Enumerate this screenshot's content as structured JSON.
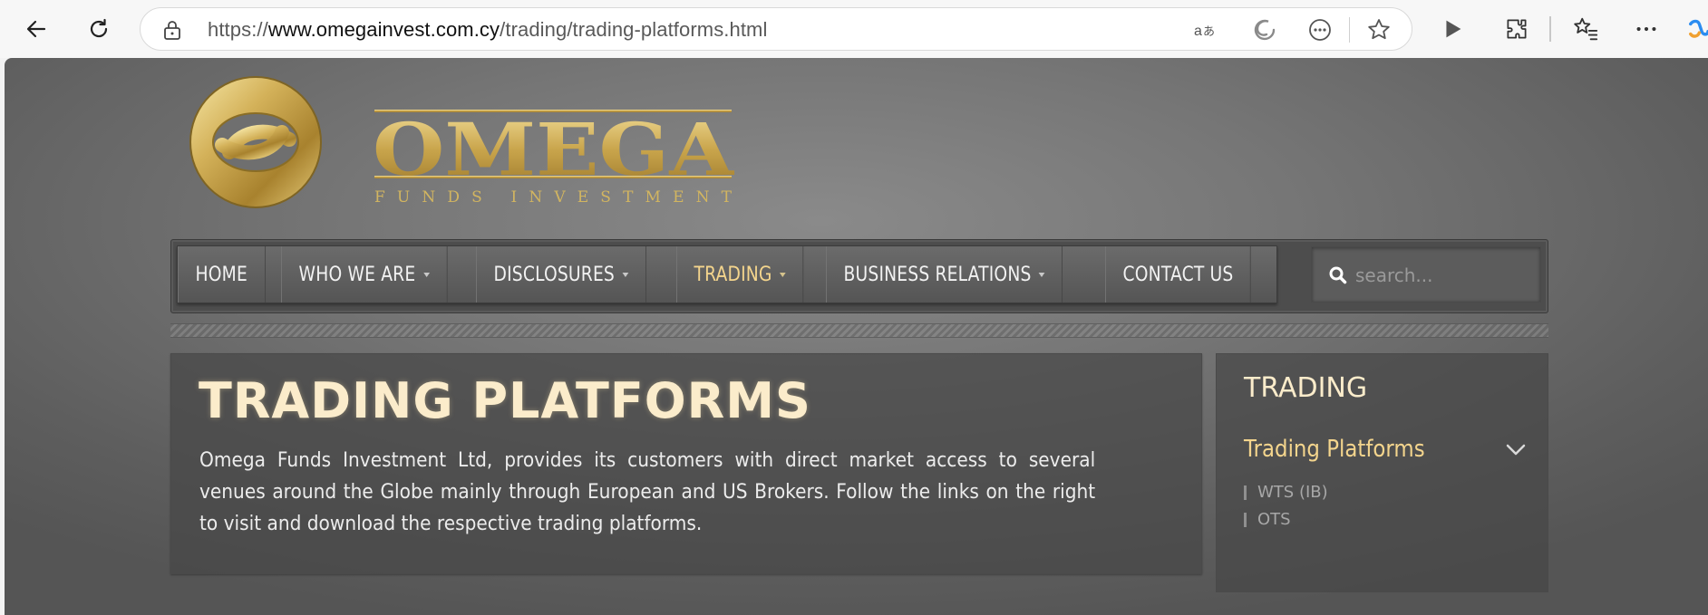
{
  "browser": {
    "url_prefix": "https://",
    "url_host": "www.omegainvest.com.cy",
    "url_path": "/trading/trading-platforms.html",
    "icons": [
      "back-icon",
      "refresh-icon",
      "lock-icon",
      "read-aloud-icon",
      "edge-icon",
      "more-tools-icon",
      "favorite-star-icon",
      "play-icon",
      "extensions-icon",
      "favorites-icon",
      "menu-dots-icon",
      "copilot-icon"
    ]
  },
  "logo": {
    "brand": "OMEGA",
    "tagline": "FUNDS INVESTMENT"
  },
  "nav": {
    "items": [
      {
        "label": "HOME",
        "has_dropdown": false,
        "active": false
      },
      {
        "label": "WHO WE ARE",
        "has_dropdown": true,
        "active": false
      },
      {
        "label": "DISCLOSURES",
        "has_dropdown": true,
        "active": false
      },
      {
        "label": "TRADING",
        "has_dropdown": true,
        "active": true
      },
      {
        "label": "BUSINESS RELATIONS",
        "has_dropdown": true,
        "active": false
      },
      {
        "label": "CONTACT US",
        "has_dropdown": false,
        "active": false
      }
    ]
  },
  "search": {
    "placeholder": "search..."
  },
  "main": {
    "title": "TRADING PLATFORMS",
    "intro": "Omega Funds Investment Ltd, provides its customers with direct market access to several venues around the Globe mainly through European and US Brokers. Follow the links on the right to visit and download the respective trading platforms."
  },
  "sidebar": {
    "title": "TRADING",
    "active_item": "Trading Platforms",
    "sub_items": [
      "WTS (IB)",
      "OTS"
    ]
  },
  "colors": {
    "accent_gold": "#f4d58d",
    "title_cream": "#fbeccb"
  }
}
